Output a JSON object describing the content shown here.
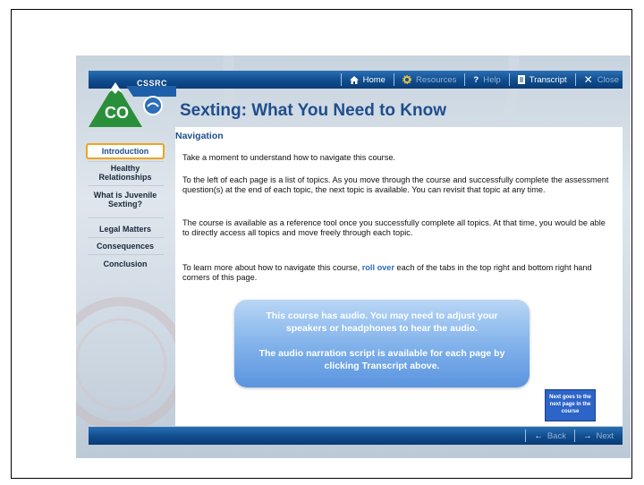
{
  "header": {
    "title": "Sexting: What You Need to Know",
    "logo_text": "CSSRC",
    "logo_state": "CO",
    "nav": [
      {
        "label": "Home",
        "icon": "home-icon"
      },
      {
        "label": "Resources",
        "icon": "gear-icon"
      },
      {
        "label": "Help",
        "icon": "question-icon"
      },
      {
        "label": "Transcript",
        "icon": "document-icon"
      },
      {
        "label": "Close",
        "icon": "close-icon"
      }
    ]
  },
  "sidebar": {
    "items": [
      {
        "label": "Introduction",
        "active": true
      },
      {
        "label": "Healthy Relationships",
        "active": false
      },
      {
        "label": "What is Juvenile Sexting?",
        "active": false
      },
      {
        "label": "Legal Matters",
        "active": false
      },
      {
        "label": "Consequences",
        "active": false
      },
      {
        "label": "Conclusion",
        "active": false
      }
    ]
  },
  "main": {
    "section_title": "Navigation",
    "paragraphs": [
      "Take a moment to understand how to navigate this course.",
      "To the left of each page is a list of  topics. As you move through the course and successfully complete the assessment question(s) at the end of each topic, the next topic is available. You can revisit that topic at any time.",
      "The course is available as a reference tool once you successfully complete all topics. At that time, you would be able to directly access all topics and move freely through each topic."
    ],
    "rollover_before": "To learn more about how to navigate this course, ",
    "rollover_link": "roll over",
    "rollover_after": " each of the tabs in the top right and bottom right hand corners of this page.",
    "audio_notice": {
      "line1": "This course has audio. You may need to adjust your speakers or headphones to hear the audio.",
      "line2": "The audio narration script is available for each page by clicking Transcript above."
    },
    "callout": "Next goes to the next page in the course"
  },
  "footer": {
    "back_label": "Back",
    "next_label": "Next"
  },
  "colors": {
    "nav_bar": "#0f4c8e",
    "title": "#1f4e8c",
    "active_border": "#f0a41b",
    "link": "#2b6bc2",
    "callout": "#2c64c8"
  }
}
